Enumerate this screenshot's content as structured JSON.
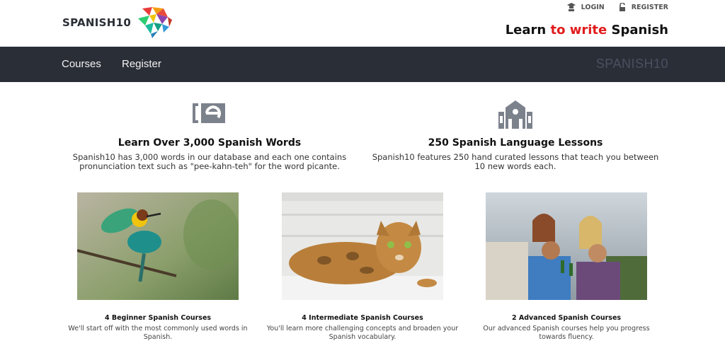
{
  "header": {
    "logo_text": "SPANISH10",
    "login_label": "LOGIN",
    "register_label": "REGISTER",
    "tagline_part1": "Learn ",
    "tagline_part2": "to write",
    "tagline_part3": " Spanish",
    "accent_color": "#e21b1b"
  },
  "nav": {
    "items": [
      {
        "label": "Courses"
      },
      {
        "label": "Register"
      }
    ],
    "brand": "SPANISH10",
    "background": "#2a2e37"
  },
  "features": [
    {
      "icon": "e-logo-icon",
      "title": "Learn Over 3,000 Spanish Words",
      "description_line1": "Spanish10 has 3,000 words in our database and each one contains",
      "description_line2": "pronunciation text such as \"pee-kahn-teh\" for the word picante."
    },
    {
      "icon": "school-building-icon",
      "title": "250 Spanish Language Lessons",
      "description_line1": "Spanish10 features 250 hand curated lessons that teach you between",
      "description_line2": "10 new words each."
    }
  ],
  "courses": [
    {
      "image": "bee-eater-bird-photo",
      "title": "4 Beginner Spanish Courses",
      "description_line1": "We'll start off with the most commonly used words in",
      "description_line2": "Spanish."
    },
    {
      "image": "bengal-cat-photo",
      "title": "4 Intermediate Spanish Courses",
      "description_line1": "You'll learn more challenging concepts and broaden your",
      "description_line2": "Spanish vocabulary."
    },
    {
      "image": "friends-toasting-photo",
      "title": "2 Advanced Spanish Courses",
      "description_line1": "Our advanced Spanish courses help you progress",
      "description_line2": "towards fluency."
    }
  ]
}
